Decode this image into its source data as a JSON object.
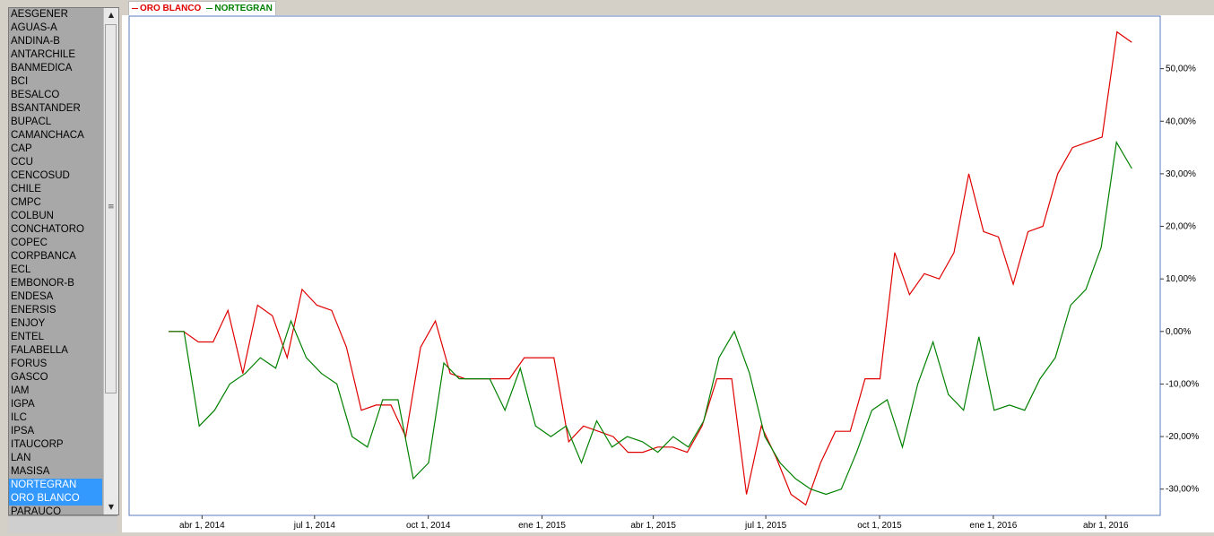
{
  "sidebar": {
    "items": [
      "AESGENER",
      "AGUAS-A",
      "ANDINA-B",
      "ANTARCHILE",
      "BANMEDICA",
      "BCI",
      "BESALCO",
      "BSANTANDER",
      "BUPACL",
      "CAMANCHACA",
      "CAP",
      "CCU",
      "CENCOSUD",
      "CHILE",
      "CMPC",
      "COLBUN",
      "CONCHATORO",
      "COPEC",
      "CORPBANCA",
      "ECL",
      "EMBONOR-B",
      "ENDESA",
      "ENERSIS",
      "ENJOY",
      "ENTEL",
      "FALABELLA",
      "FORUS",
      "GASCO",
      "IAM",
      "IGPA",
      "ILC",
      "IPSA",
      "ITAUCORP",
      "LAN",
      "MASISA",
      "NORTEGRAN",
      "ORO BLANCO",
      "PARAUCO"
    ],
    "selected": [
      "NORTEGRAN",
      "ORO BLANCO"
    ]
  },
  "chart_data": {
    "type": "line",
    "title": "",
    "xlabel": "",
    "ylabel": "",
    "x_ticks": [
      "abr 1, 2014",
      "jul 1, 2014",
      "oct 1, 2014",
      "ene 1, 2015",
      "abr 1, 2015",
      "jul 1, 2015",
      "oct 1, 2015",
      "ene 1, 2016",
      "abr 1, 2016"
    ],
    "y_ticks": [
      "50,00%",
      "40,00%",
      "30,00%",
      "20,00%",
      "10,00%",
      "0,00%",
      "-10,00%",
      "-20,00%",
      "-30,00%"
    ],
    "ylim": [
      -35,
      60
    ],
    "grid": false,
    "legend_position": "top-left",
    "colors": {
      "ORO BLANCO": "#e00000",
      "NORTEGRAN": "#008000"
    },
    "x": [
      "2014-03-05",
      "2014-03-15",
      "2014-03-20",
      "2014-03-27",
      "2014-04-02",
      "2014-04-10",
      "2014-04-20",
      "2014-04-28",
      "2014-05-10",
      "2014-05-20",
      "2014-06-01",
      "2014-06-10",
      "2014-06-20",
      "2014-07-01",
      "2014-07-15",
      "2014-08-01",
      "2014-08-20",
      "2014-09-01",
      "2014-09-10",
      "2014-09-20",
      "2014-10-01",
      "2014-10-15",
      "2014-11-01",
      "2014-11-15",
      "2014-12-01",
      "2014-12-15",
      "2015-01-01",
      "2015-01-15",
      "2015-02-01",
      "2015-02-15",
      "2015-03-01",
      "2015-03-15",
      "2015-04-01",
      "2015-04-15",
      "2015-05-01",
      "2015-05-15",
      "2015-06-01",
      "2015-06-15",
      "2015-07-01",
      "2015-07-15",
      "2015-08-01",
      "2015-08-15",
      "2015-09-01",
      "2015-09-15",
      "2015-10-01",
      "2015-10-15",
      "2015-11-01",
      "2015-11-15",
      "2015-12-01",
      "2015-12-15",
      "2016-01-01",
      "2016-01-15",
      "2016-02-01",
      "2016-02-15",
      "2016-03-01",
      "2016-03-15",
      "2016-04-01",
      "2016-04-15",
      "2016-04-22"
    ],
    "series": [
      {
        "name": "ORO BLANCO",
        "values": [
          0,
          0,
          -2,
          -2,
          4,
          -8,
          5,
          3,
          -5,
          8,
          5,
          4,
          -3,
          -15,
          -14,
          -14,
          -20,
          -3,
          2,
          -8,
          -9,
          -9,
          -9,
          -9,
          -5,
          -5,
          -5,
          -21,
          -18,
          -19,
          -20,
          -23,
          -23,
          -22,
          -22,
          -23,
          -18,
          -9,
          -9,
          -31,
          -18,
          -24,
          -31,
          -33,
          -25,
          -19,
          -19,
          -9,
          -9,
          15,
          7,
          11,
          10,
          15,
          30,
          19,
          18,
          9,
          19,
          20,
          30,
          35,
          36,
          37,
          57,
          55
        ]
      },
      {
        "name": "NORTEGRAN",
        "values": [
          0,
          0,
          -18,
          -15,
          -10,
          -8,
          -5,
          -7,
          2,
          -5,
          -8,
          -10,
          -20,
          -22,
          -13,
          -13,
          -28,
          -25,
          -6,
          -9,
          -9,
          -9,
          -15,
          -7,
          -18,
          -20,
          -18,
          -25,
          -17,
          -22,
          -20,
          -21,
          -23,
          -20,
          -22,
          -17,
          -5,
          0,
          -8,
          -20,
          -25,
          -28,
          -30,
          -31,
          -30,
          -23,
          -15,
          -13,
          -22,
          -10,
          -2,
          -12,
          -15,
          -1,
          -15,
          -14,
          -15,
          -9,
          -5,
          5,
          8,
          16,
          36,
          31
        ]
      }
    ]
  }
}
